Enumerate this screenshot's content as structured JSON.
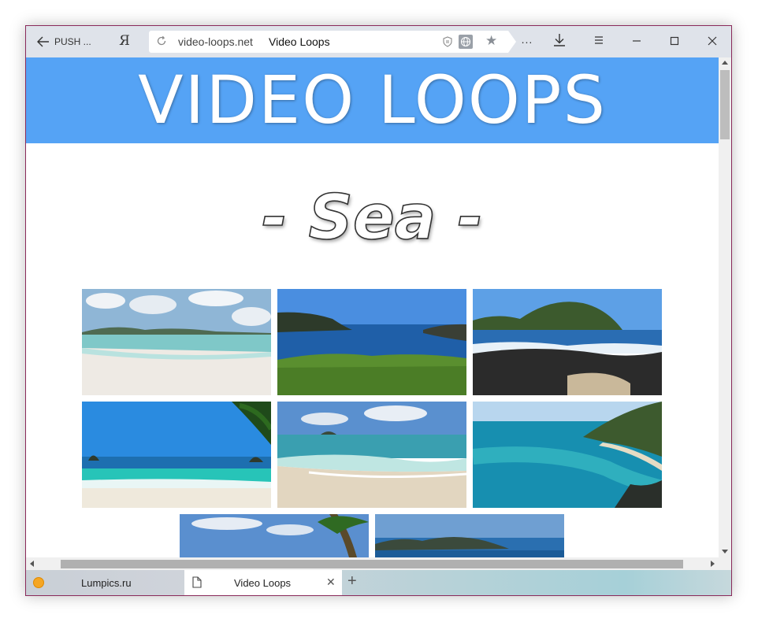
{
  "browser": {
    "back_label": "PUSH ...",
    "yandex_button": "Я",
    "address": {
      "url": "video-loops.net",
      "page_title": "Video Loops"
    },
    "toolbar": {
      "more_label": "..."
    }
  },
  "page": {
    "banner_title": "VIDEO LOOPS",
    "section_title": "- Sea -"
  },
  "tabs": [
    {
      "label": "Lumpics.ru",
      "active": false
    },
    {
      "label": "Video Loops",
      "active": true
    }
  ],
  "colors": {
    "banner": "#55a3f5",
    "window_border": "#8a2a5a"
  },
  "icons": [
    "arrow-left-icon",
    "reload-icon",
    "shield-icon",
    "globe-icon",
    "star-icon",
    "download-icon",
    "menu-icon",
    "minimize-icon",
    "maximize-icon",
    "close-icon",
    "page-icon",
    "plus-icon"
  ]
}
